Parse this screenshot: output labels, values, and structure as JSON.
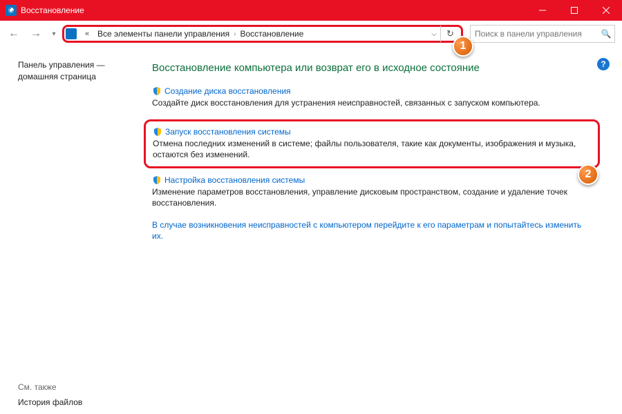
{
  "window": {
    "title": "Восстановление"
  },
  "nav": {
    "breadcrumb_prefix": "«",
    "segments": [
      "Все элементы панели управления",
      "Восстановление"
    ]
  },
  "search": {
    "placeholder": "Поиск в панели управления"
  },
  "sidebar": {
    "home": "Панель управления — домашняя страница",
    "see_also": "См. также",
    "file_history": "История файлов"
  },
  "content": {
    "heading": "Восстановление компьютера или возврат его в исходное состояние",
    "items": [
      {
        "title": "Создание диска восстановления",
        "desc": "Создайте диск восстановления для устранения неисправностей, связанных с запуском компьютера."
      },
      {
        "title": "Запуск восстановления системы",
        "desc": "Отмена последних изменений в системе; файлы пользователя, такие как документы, изображения и музыка, остаются без изменений."
      },
      {
        "title": "Настройка восстановления системы",
        "desc": "Изменение параметров восстановления, управление дисковым пространством, создание и удаление точек восстановления."
      }
    ],
    "footnote": "В случае возникновения неисправностей с компьютером перейдите к его параметрам и попытайтесь изменить их."
  },
  "annotations": {
    "b1": "1",
    "b2": "2"
  }
}
